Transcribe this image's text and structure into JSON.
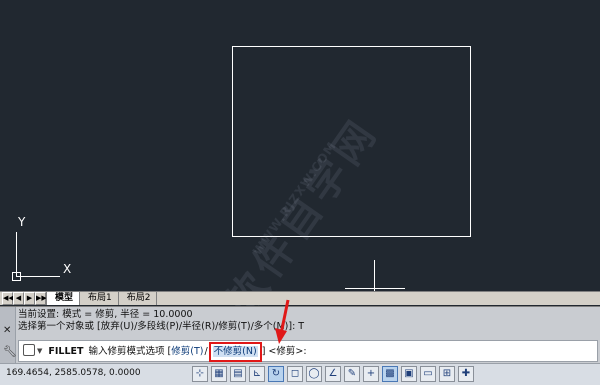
{
  "layout_tabs": {
    "nav": [
      "◀◀",
      "◀",
      "▶",
      "▶▶"
    ],
    "items": [
      "模型",
      "布局1",
      "布局2"
    ],
    "active": 0
  },
  "command": {
    "history": [
      "当前设置: 模式 = 修剪, 半径 = 10.0000",
      "选择第一个对象或 [放弃(U)/多段线(P)/半径(R)/修剪(T)/多个(M)]: T"
    ],
    "cmd_name": "FILLET",
    "prompt_text": "输入修剪模式选项 [",
    "option_trim": "修剪(T)",
    "option_sep": "/",
    "option_notrim": "不修剪(N)",
    "prompt_end": "] <修剪>:"
  },
  "status": {
    "coords": "169.4654, 2585.0578, 0.0000",
    "tools": [
      "⊹",
      "▦",
      "▤",
      "⊾",
      "↻",
      "◻",
      "◯",
      "∠",
      "✎",
      "+",
      "▩",
      "▣",
      "▭",
      "⊞",
      "✚"
    ]
  },
  "ucs": {
    "x": "X",
    "y": "Y"
  },
  "colors": {
    "canvas": "#212830",
    "highlight": "#e01818"
  }
}
